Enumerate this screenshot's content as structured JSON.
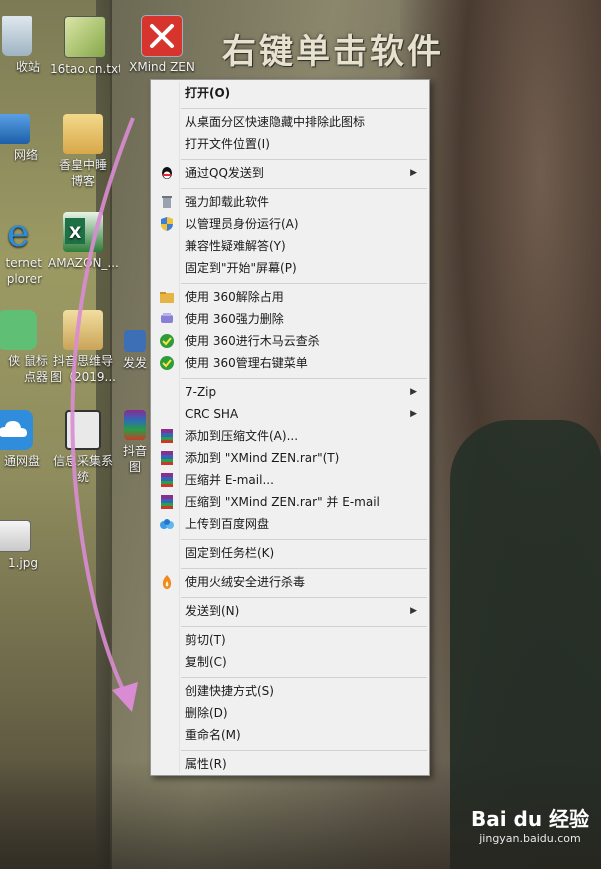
{
  "annotation_title": "右键单击软件",
  "desktop_icons": [
    {
      "label": "收站"
    },
    {
      "label": "16tao.cn.txt"
    },
    {
      "label": "XMind ZEN"
    },
    {
      "label": "网络"
    },
    {
      "label": "香皇中睡博客"
    },
    {
      "label": "ternet\nplorer"
    },
    {
      "label": "AMAZON_..."
    },
    {
      "label": "侠 鼠标\n点器"
    },
    {
      "label": "抖音思维导\n图（2019..."
    },
    {
      "label": "发发"
    },
    {
      "label": "通网盘"
    },
    {
      "label": "信息采集系\n统"
    },
    {
      "label": "抖音\n图"
    },
    {
      "label": "1.jpg"
    }
  ],
  "context_menu": {
    "items": [
      {
        "label": "打开(O)",
        "bold": true,
        "icon": "none"
      },
      {
        "label": "从桌面分区快速隐藏中排除此图标",
        "icon": "none"
      },
      {
        "label": "打开文件位置(I)",
        "icon": "none"
      },
      {
        "label": "通过QQ发送到",
        "icon": "qq-icon",
        "submenu": true
      },
      {
        "label": "强力卸载此软件",
        "icon": "trash-icon"
      },
      {
        "label": "以管理员身份运行(A)",
        "icon": "shield-icon"
      },
      {
        "label": "兼容性疑难解答(Y)",
        "icon": "none"
      },
      {
        "label": "固定到\"开始\"屏幕(P)",
        "icon": "none"
      },
      {
        "label": "使用 360解除占用",
        "icon": "folder-360-icon"
      },
      {
        "label": "使用 360强力删除",
        "icon": "shredder-360-icon"
      },
      {
        "label": "使用 360进行木马云查杀",
        "icon": "shield-360-icon"
      },
      {
        "label": "使用 360管理右键菜单",
        "icon": "shield-360-icon"
      },
      {
        "label": "7-Zip",
        "icon": "none",
        "submenu": true
      },
      {
        "label": "CRC SHA",
        "icon": "none",
        "submenu": true
      },
      {
        "label": "添加到压缩文件(A)...",
        "icon": "winrar-icon"
      },
      {
        "label": "添加到 \"XMind ZEN.rar\"(T)",
        "icon": "winrar-icon"
      },
      {
        "label": "压缩并 E-mail...",
        "icon": "winrar-icon"
      },
      {
        "label": "压缩到 \"XMind ZEN.rar\" 并 E-mail",
        "icon": "winrar-icon"
      },
      {
        "label": "上传到百度网盘",
        "icon": "baidu-netdisk-icon"
      },
      {
        "label": "固定到任务栏(K)",
        "icon": "none"
      },
      {
        "label": "使用火绒安全进行杀毒",
        "icon": "huorong-icon"
      },
      {
        "label": "发送到(N)",
        "icon": "none",
        "submenu": true
      },
      {
        "label": "剪切(T)",
        "icon": "none"
      },
      {
        "label": "复制(C)",
        "icon": "none"
      },
      {
        "label": "创建快捷方式(S)",
        "icon": "none"
      },
      {
        "label": "删除(D)",
        "icon": "none"
      },
      {
        "label": "重命名(M)",
        "icon": "none"
      },
      {
        "label": "属性(R)",
        "icon": "none"
      }
    ],
    "submenu_arrow": "▶"
  },
  "watermark": {
    "brand": "Bai du 经验",
    "url": "jingyan.baidu.com"
  },
  "colors": {
    "menu_bg": "#f0f0f0",
    "menu_border": "#979797",
    "arrow_annotation": "#d77fd1"
  }
}
